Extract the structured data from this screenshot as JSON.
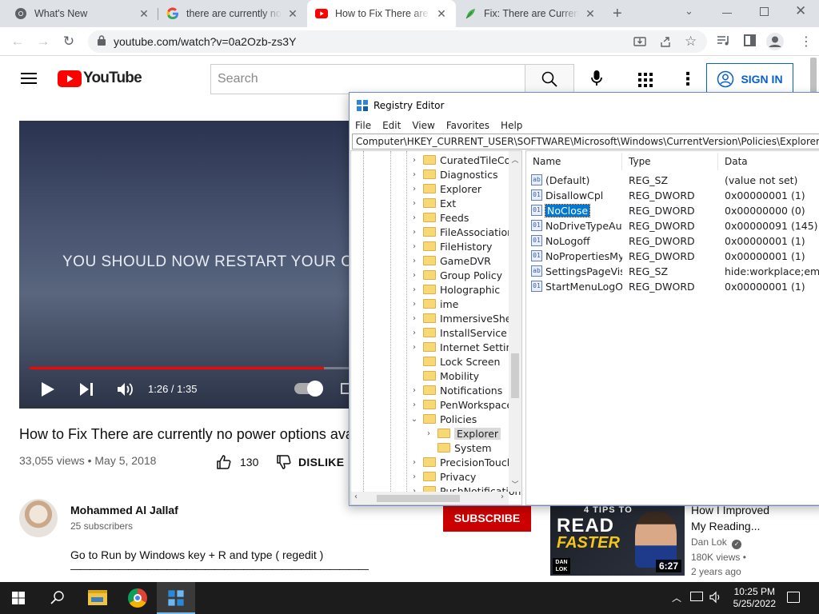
{
  "browser": {
    "tabs": [
      {
        "title": "What's New",
        "active": false
      },
      {
        "title": "there are currently no power options",
        "active": false
      },
      {
        "title": "How to Fix There are currently no",
        "active": true
      },
      {
        "title": "Fix: There are Currently No Power",
        "active": false
      }
    ],
    "url": "youtube.com/watch?v=0a2Ozb-zs3Y"
  },
  "youtube": {
    "logo_text": "YouTube",
    "search_placeholder": "Search",
    "signin_label": "SIGN IN",
    "video": {
      "caption_line": "YOU SHOULD NOW RESTART YOUR COM",
      "time": "1:26 / 1:35",
      "progress": 0.905
    },
    "title": "How to Fix There are currently no power options ava",
    "views_date": "33,055 views • May 5, 2018",
    "like_count": "130",
    "dislike_label": "DISLIKE",
    "channel_name": "Mohammed Al Jallaf",
    "subscribers": "25 subscribers",
    "subscribe_label": "SUBSCRIBE",
    "description": "Go to Run by Windows key + R and type ( regedit )",
    "description_divider": "———————————————————————————————",
    "recommended": {
      "title_line1": "How I Improved",
      "title_line2": "My Reading...",
      "channel": "Dan Lok",
      "views": "180K views •",
      "age": "2 years ago",
      "duration": "6:27",
      "thumb_top": "4 TIPS TO",
      "thumb_big1": "READ",
      "thumb_big2": "FASTER",
      "thumb_logo": "DAN LOK"
    }
  },
  "regedit": {
    "title": "Registry Editor",
    "menu": [
      "File",
      "Edit",
      "View",
      "Favorites",
      "Help"
    ],
    "path": "Computer\\HKEY_CURRENT_USER\\SOFTWARE\\Microsoft\\Windows\\CurrentVersion\\Policies\\Explorer",
    "tree": [
      {
        "label": "CuratedTileColle",
        "expander": "›",
        "indent": 1
      },
      {
        "label": "Diagnostics",
        "expander": "›",
        "indent": 1
      },
      {
        "label": "Explorer",
        "expander": "›",
        "indent": 1
      },
      {
        "label": "Ext",
        "expander": "›",
        "indent": 1
      },
      {
        "label": "Feeds",
        "expander": "›",
        "indent": 1
      },
      {
        "label": "FileAssociations",
        "expander": "›",
        "indent": 1
      },
      {
        "label": "FileHistory",
        "expander": "›",
        "indent": 1
      },
      {
        "label": "GameDVR",
        "expander": "›",
        "indent": 1
      },
      {
        "label": "Group Policy",
        "expander": "›",
        "indent": 1
      },
      {
        "label": "Holographic",
        "expander": "›",
        "indent": 1
      },
      {
        "label": "ime",
        "expander": "›",
        "indent": 1
      },
      {
        "label": "ImmersiveShell",
        "expander": "›",
        "indent": 1
      },
      {
        "label": "InstallService",
        "expander": "›",
        "indent": 1
      },
      {
        "label": "Internet Settings",
        "expander": "›",
        "indent": 1
      },
      {
        "label": "Lock Screen",
        "expander": "",
        "indent": 1
      },
      {
        "label": "Mobility",
        "expander": "",
        "indent": 1
      },
      {
        "label": "Notifications",
        "expander": "›",
        "indent": 1
      },
      {
        "label": "PenWorkspace",
        "expander": "›",
        "indent": 1
      },
      {
        "label": "Policies",
        "expander": "⌄",
        "indent": 1
      },
      {
        "label": "Explorer",
        "expander": "›",
        "indent": 2,
        "selected": true
      },
      {
        "label": "System",
        "expander": "",
        "indent": 2
      },
      {
        "label": "PrecisionTouchP",
        "expander": "›",
        "indent": 1
      },
      {
        "label": "Privacy",
        "expander": "›",
        "indent": 1
      },
      {
        "label": "PushNotification",
        "expander": "›",
        "indent": 1
      }
    ],
    "columns": [
      "Name",
      "Type",
      "Data"
    ],
    "values": [
      {
        "icon": "ab",
        "name": "(Default)",
        "type": "REG_SZ",
        "data": "(value not set)"
      },
      {
        "icon": "01",
        "name": "DisallowCpl",
        "type": "REG_DWORD",
        "data": "0x00000001 (1)"
      },
      {
        "icon": "01",
        "name": "NoClose",
        "type": "REG_DWORD",
        "data": "0x00000000 (0)",
        "selected": true
      },
      {
        "icon": "01",
        "name": "NoDriveTypeAut...",
        "type": "REG_DWORD",
        "data": "0x00000091 (145)"
      },
      {
        "icon": "01",
        "name": "NoLogoff",
        "type": "REG_DWORD",
        "data": "0x00000001 (1)"
      },
      {
        "icon": "01",
        "name": "NoPropertiesMy...",
        "type": "REG_DWORD",
        "data": "0x00000001 (1)"
      },
      {
        "icon": "ab",
        "name": "SettingsPageVisi...",
        "type": "REG_SZ",
        "data": "hide:workplace;emaila"
      },
      {
        "icon": "01",
        "name": "StartMenuLogOff",
        "type": "REG_DWORD",
        "data": "0x00000001 (1)"
      }
    ]
  },
  "taskbar": {
    "time": "10:25 PM",
    "date": "5/25/2022"
  },
  "colors": {
    "youtube_red": "#ff0000",
    "subscribe_red": "#cc0000",
    "link_blue": "#065fd4",
    "regedit_selected": "#0078d7",
    "taskbar": "#1c1c1c"
  }
}
